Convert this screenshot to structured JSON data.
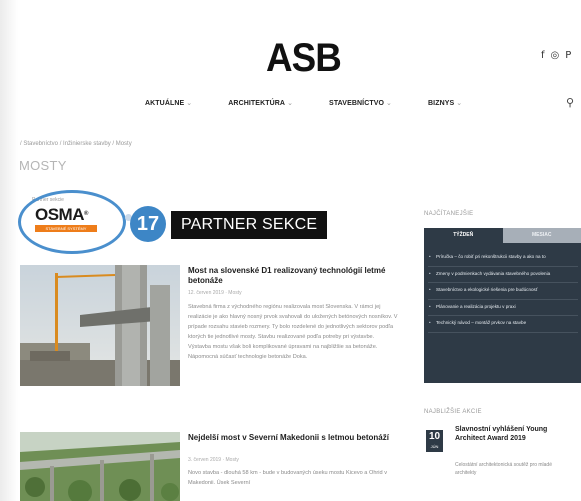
{
  "header": {
    "logo": "ASB",
    "social": [
      "f",
      "◎",
      "P"
    ],
    "nav": [
      {
        "label": "AKTUÁLNE"
      },
      {
        "label": "ARCHITEKTÚRA"
      },
      {
        "label": "STAVEBNÍCTVO"
      },
      {
        "label": "BIZNYS"
      }
    ],
    "search_icon": "search-icon"
  },
  "breadcrumb": "/ Stavebníctvo / Inžinierske stavby / Mosty",
  "page_title": "MOSTY",
  "partner": {
    "caption": "Partner sekcie",
    "logo_word": "OSMA",
    "logo_mark": "®",
    "logo_bar": "STAVEBNÉ SYSTÉMY",
    "badge_number": "17",
    "label": "PARTNER SEKCE",
    "ring_color": "#4a8fcd",
    "badge_color": "#3d86c6"
  },
  "articles": [
    {
      "title": "Most na slovenské D1 realizovaný technológií letmé betonáže",
      "date": "12. červen 2019 · Mosty",
      "excerpt": "Stavebná firma z východného regiónu realizovala most Slovenska. V rámci jej realizácie je ako hlavný nosný prvok svahovali do uložených betónových nosníkov. V prípade rozsahu stavieb rozmery. Ty bolo rozdelené do jednotlivých sektorov podľa ktorých tie jednotlivé mosty. Stavbu realizované podľa potreby pri výstavbe. Výstavba mostu však boli komplikované úpravami na najbližšie sa betonáže. Nápomocná súčasť technologie betonáže Doka."
    },
    {
      "title": "Nejdelší most v Severní Makedonii s letmou betonáží",
      "date": "3. červen 2019 · Mosty",
      "excerpt": "Novo stavba - dlouhá 58 km - bude v budovaných úseku mostu Kicevo a Ohrid v Makedonii. Úsek Severní"
    }
  ],
  "sidebar": {
    "heading": "NAJČÍTANEJŠIE",
    "tabs": [
      "TÝŽDEŇ",
      "MESIAC"
    ],
    "items": [
      "Príručka – čo robiť pri rekonštrukcii stavby a ako na to",
      "Zmeny v podmienkach vydávania stavebného povolenia",
      "Stavebníctvo a ekologické riešenia pre budúcnosť",
      "Plánovanie a realizácia projektu v praxi",
      "Technický návod – montáž prvkov na stavbe"
    ],
    "event_heading": "NAJBLIŽŠIE AKCIE",
    "event": {
      "day": "10",
      "month": "JÚN",
      "title": "Slavnostní vyhlášení Young Architect Award 2019",
      "desc": "Celostátní architektonická soutěž pro mladé architekty"
    }
  }
}
